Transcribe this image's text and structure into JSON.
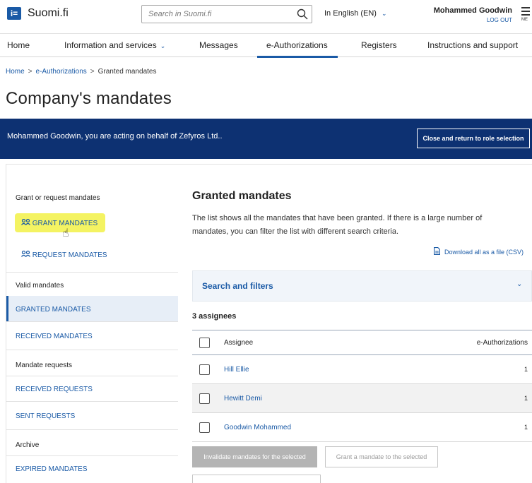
{
  "header": {
    "logo_mark": "i=",
    "site_name": "Suomi.fi",
    "search_placeholder": "Search in Suomi.fi",
    "language": "In English (EN)",
    "user_name": "Mohammed Goodwin",
    "logout": "LOG OUT",
    "menu_label": "ME"
  },
  "nav": {
    "items": [
      {
        "label": "Home"
      },
      {
        "label": "Information and services"
      },
      {
        "label": "Messages"
      },
      {
        "label": "e-Authorizations"
      },
      {
        "label": "Registers"
      },
      {
        "label": "Instructions and support"
      }
    ],
    "active": "e-Authorizations"
  },
  "breadcrumb": {
    "home": "Home",
    "section": "e-Authorizations",
    "current": "Granted mandates",
    "separator": ">"
  },
  "page_title": "Company's mandates",
  "banner": {
    "message": "Mohammed Goodwin, you are acting on behalf of Zefyros Ltd..",
    "button": "Close and return to role selection"
  },
  "sidebar": {
    "grant_or_request_heading": "Grant or request mandates",
    "grant_mandates": "GRANT MANDATES",
    "request_mandates": "REQUEST MANDATES",
    "valid_heading": "Valid mandates",
    "granted_mandates": "GRANTED MANDATES",
    "received_mandates": "RECEIVED MANDATES",
    "requests_heading": "Mandate requests",
    "received_requests": "RECEIVED REQUESTS",
    "sent_requests": "SENT REQUESTS",
    "archive_heading": "Archive",
    "expired_mandates": "EXPIRED MANDATES"
  },
  "main": {
    "title": "Granted mandates",
    "description": "The list shows all the mandates that have been granted. If there is a large number of mandates, you can filter the list with different search criteria.",
    "download": "Download all as a file (CSV)",
    "filters_label": "Search and filters",
    "assignee_count": "3 assignees",
    "table": {
      "col_assignee": "Assignee",
      "col_auth": "e-Authorizations",
      "rows": [
        {
          "name": "Hill Ellie",
          "count": "1"
        },
        {
          "name": "Hewitt Demi",
          "count": "1"
        },
        {
          "name": "Goodwin Mohammed",
          "count": "1"
        }
      ]
    },
    "invalidate_button": "Invalidate mandates for the selected",
    "grant_button": "Grant a mandate to the selected"
  },
  "colors": {
    "brand_blue": "#1a5aa6",
    "banner_navy": "#0d3172",
    "highlight_yellow": "#f3f25a"
  }
}
